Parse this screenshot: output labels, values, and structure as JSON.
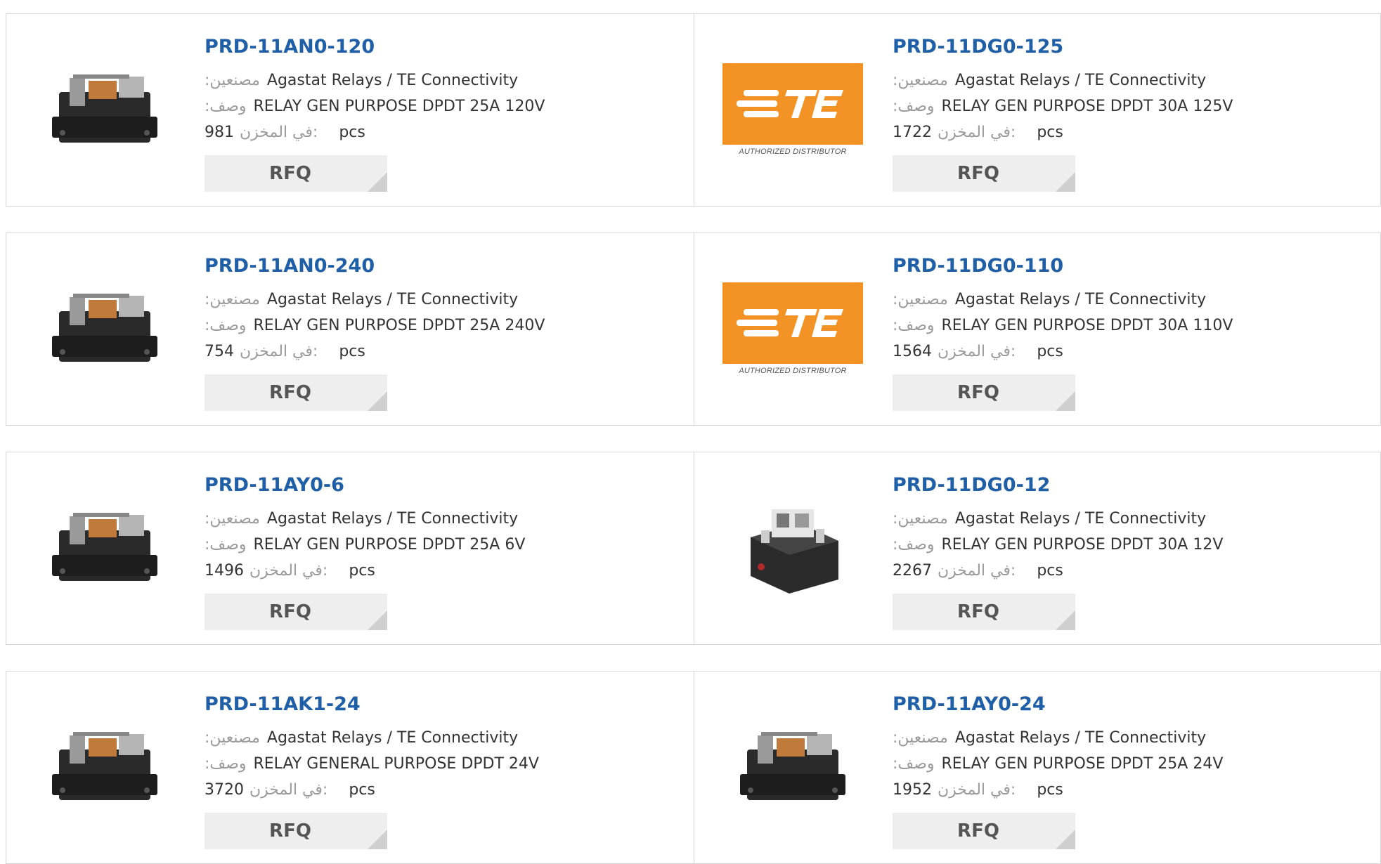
{
  "labels": {
    "manufacturer": ":مصنعين",
    "description": ":وصف",
    "stock": "في المخزن:",
    "unit": "pcs",
    "rfq": "RFQ",
    "te_caption": "AUTHORIZED DISTRIBUTOR"
  },
  "colors": {
    "title": "#1f5fa8",
    "label": "#9a9a9a",
    "rfq_bg": "#eeeeee",
    "te_orange": "#f39325"
  },
  "products": [
    {
      "part": "PRD-11AN0-120",
      "manufacturer": "Agastat Relays / TE Connectivity",
      "description": "RELAY GEN PURPOSE DPDT 25A 120V",
      "stock": "981",
      "image": "relay-photo"
    },
    {
      "part": "PRD-11DG0-125",
      "manufacturer": "Agastat Relays / TE Connectivity",
      "description": "RELAY GEN PURPOSE DPDT 30A 125V",
      "stock": "1722",
      "image": "te-logo"
    },
    {
      "part": "PRD-11AN0-240",
      "manufacturer": "Agastat Relays / TE Connectivity",
      "description": "RELAY GEN PURPOSE DPDT 25A 240V",
      "stock": "754",
      "image": "relay-photo"
    },
    {
      "part": "PRD-11DG0-110",
      "manufacturer": "Agastat Relays / TE Connectivity",
      "description": "RELAY GEN PURPOSE DPDT 30A 110V",
      "stock": "1564",
      "image": "te-logo"
    },
    {
      "part": "PRD-11AY0-6",
      "manufacturer": "Agastat Relays / TE Connectivity",
      "description": "RELAY GEN PURPOSE DPDT 25A 6V",
      "stock": "1496",
      "image": "relay-photo"
    },
    {
      "part": "PRD-11DG0-12",
      "manufacturer": "Agastat Relays / TE Connectivity",
      "description": "RELAY GEN PURPOSE DPDT 30A 12V",
      "stock": "2267",
      "image": "relay-photo-open"
    },
    {
      "part": "PRD-11AK1-24",
      "manufacturer": "Agastat Relays / TE Connectivity",
      "description": "RELAY GENERAL PURPOSE DPDT 24V",
      "stock": "3720",
      "image": "relay-photo"
    },
    {
      "part": "PRD-11AY0-24",
      "manufacturer": "Agastat Relays / TE Connectivity",
      "description": "RELAY GEN PURPOSE DPDT 25A 24V",
      "stock": "1952",
      "image": "relay-photo"
    }
  ]
}
